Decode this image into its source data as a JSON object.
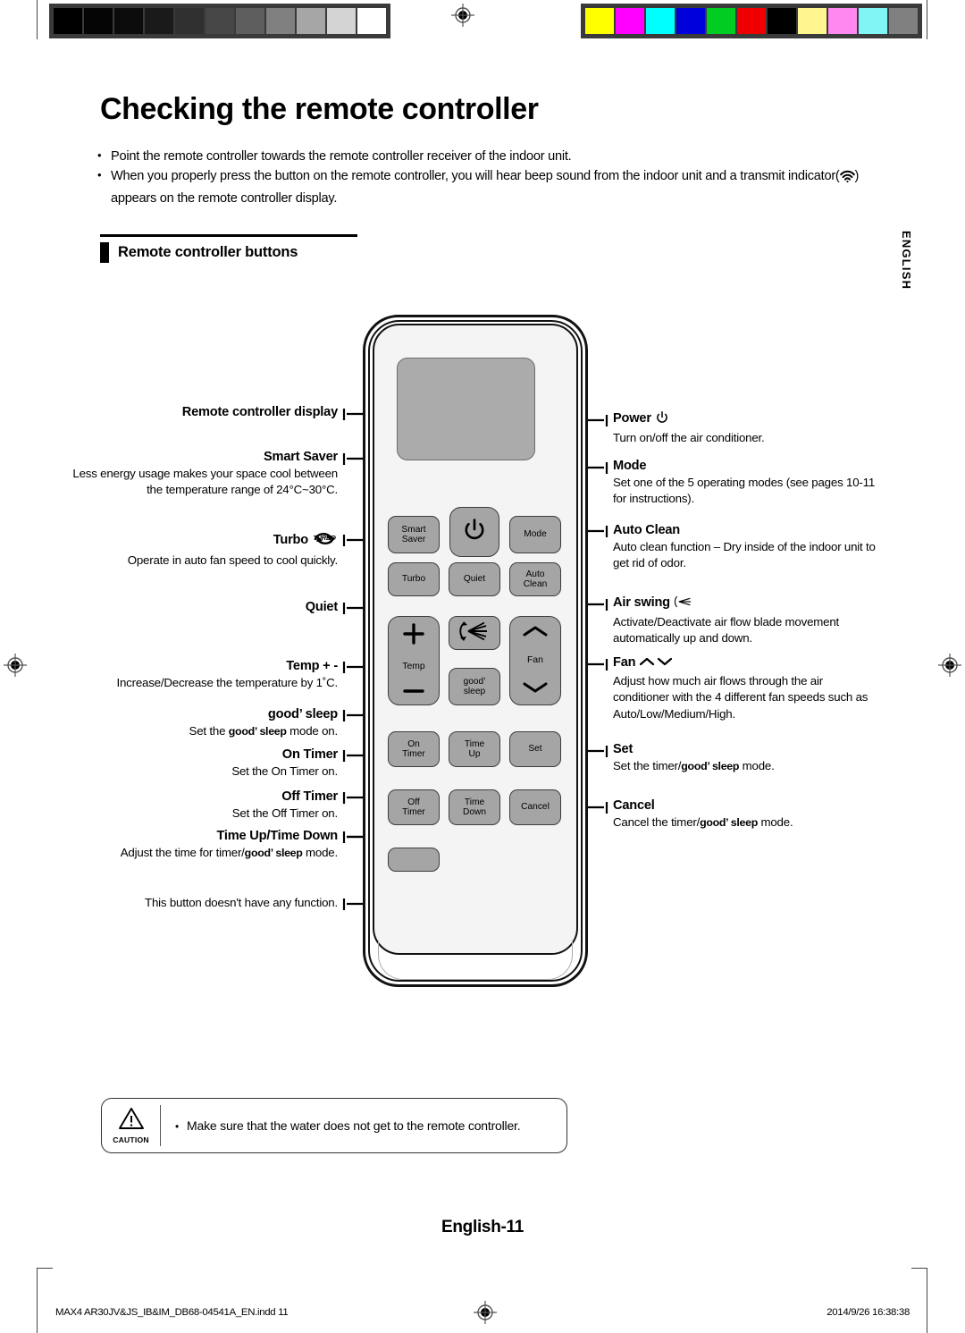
{
  "header": {
    "title": "Checking the remote controller",
    "bullets": [
      "Point the remote controller towards the remote controller receiver of the indoor unit.",
      "When you properly press the button on the remote controller, you will hear beep sound from the indoor unit and a transmit indicator(    ) appears on the remote controller display."
    ],
    "bullet2_part1": "When you properly press the button on the remote controller, you will hear beep sound from the indoor unit and a transmit",
    "bullet2_part2a": "indicator(",
    "bullet2_part2b": ") appears on the remote controller display."
  },
  "section": {
    "heading": "Remote controller buttons"
  },
  "side_tab": {
    "label": "ENGLISH"
  },
  "annotations_left": [
    {
      "id": "display",
      "label": "Remote controller display",
      "desc": ""
    },
    {
      "id": "smart-saver",
      "label": "Smart Saver",
      "desc": "Less energy usage makes your space cool between the temperature range of 24°C~30°C."
    },
    {
      "id": "turbo",
      "label": "Turbo",
      "icon": "TURBO",
      "desc": "Operate in auto fan speed to cool quickly."
    },
    {
      "id": "quiet",
      "label": "Quiet",
      "desc": ""
    },
    {
      "id": "temp",
      "label": "Temp + -",
      "desc": "Increase/Decrease the temperature by 1˚C."
    },
    {
      "id": "good-sleep",
      "label": "good’ sleep",
      "desc_pre": "Set the ",
      "desc_bold": "good’ sleep",
      "desc_post": " mode on."
    },
    {
      "id": "on-timer",
      "label": "On Timer",
      "desc": "Set the On Timer on."
    },
    {
      "id": "off-timer",
      "label": "Off Timer",
      "desc": "Set the Off Timer on."
    },
    {
      "id": "time-up-down",
      "label": "Time Up/Time Down",
      "desc_pre": "Adjust the time for timer/",
      "desc_bold": "good’ sleep",
      "desc_post": " mode."
    },
    {
      "id": "no-function",
      "label": "",
      "desc": "This button doesn't have any function."
    }
  ],
  "annotations_right": [
    {
      "id": "power",
      "label": "Power",
      "icon": "power-icon",
      "desc": "Turn on/off the air conditioner."
    },
    {
      "id": "mode",
      "label": "Mode",
      "desc": "Set one of the 5 operating modes (see pages 10-11 for instructions)."
    },
    {
      "id": "auto-clean",
      "label": "Auto Clean",
      "desc": "Auto clean function – Dry inside of the indoor unit to get rid of odor."
    },
    {
      "id": "air-swing",
      "label": "Air swing",
      "icon": "air-swing-icon",
      "desc": "Activate/Deactivate air flow blade movement automatically up and down."
    },
    {
      "id": "fan",
      "label": "Fan",
      "icon": "fan-arrows-icon",
      "desc": "Adjust how much air flows through the air conditioner with the 4 different fan speeds such as Auto/Low/Medium/High."
    },
    {
      "id": "set",
      "label": "Set",
      "desc_pre": "Set the timer/",
      "desc_bold": "good’ sleep",
      "desc_post": " mode."
    },
    {
      "id": "cancel",
      "label": "Cancel",
      "desc_pre": "Cancel the timer/",
      "desc_bold": "good’ sleep",
      "desc_post": " mode."
    }
  ],
  "remote_buttons": [
    {
      "id": "smart-saver",
      "line1": "Smart",
      "line2": "Saver"
    },
    {
      "id": "power",
      "line1": "",
      "icon": "power-icon"
    },
    {
      "id": "mode",
      "line1": "Mode"
    },
    {
      "id": "turbo",
      "line1": "Turbo"
    },
    {
      "id": "quiet",
      "line1": "Quiet"
    },
    {
      "id": "auto-clean",
      "line1": "Auto",
      "line2": "Clean"
    },
    {
      "id": "temp",
      "line1": "Temp",
      "icon": "plus-minus-icon"
    },
    {
      "id": "air-swing",
      "line1": "",
      "icon": "air-swing-icon"
    },
    {
      "id": "fan",
      "line1": "Fan",
      "icon": "fan-arrows-icon"
    },
    {
      "id": "good-sleep",
      "line1": "good’",
      "line2": "sleep"
    },
    {
      "id": "on-timer",
      "line1": "On",
      "line2": "Timer"
    },
    {
      "id": "time-up",
      "line1": "Time",
      "line2": "Up"
    },
    {
      "id": "set",
      "line1": "Set"
    },
    {
      "id": "off-timer",
      "line1": "Off",
      "line2": "Timer"
    },
    {
      "id": "time-down",
      "line1": "Time",
      "line2": "Down"
    },
    {
      "id": "cancel",
      "line1": "Cancel"
    },
    {
      "id": "no-function",
      "line1": ""
    }
  ],
  "caution": {
    "word": "CAUTION",
    "text": "Make sure that the water does not get to the remote controller."
  },
  "footer": {
    "page": "English-11",
    "file": "MAX4 AR30JV&JS_IB&IM_DB68-04541A_EN.indd   11",
    "date": "2014/9/26   16:38:38"
  },
  "calibration": {
    "gray_swatches": [
      "#000000",
      "#050505",
      "#0c0c0c",
      "#1a1a1a",
      "#303030",
      "#474747",
      "#5e5e5e",
      "#808080",
      "#a6a6a6",
      "#d4d4d4",
      "#ffffff"
    ],
    "color_swatches": [
      "#ffff00",
      "#ff00ff",
      "#00ffff",
      "#0000dd",
      "#00cc22",
      "#ee0000",
      "#000000",
      "#fff68f",
      "#ff88f0",
      "#7ff5f5",
      "#808080"
    ]
  }
}
